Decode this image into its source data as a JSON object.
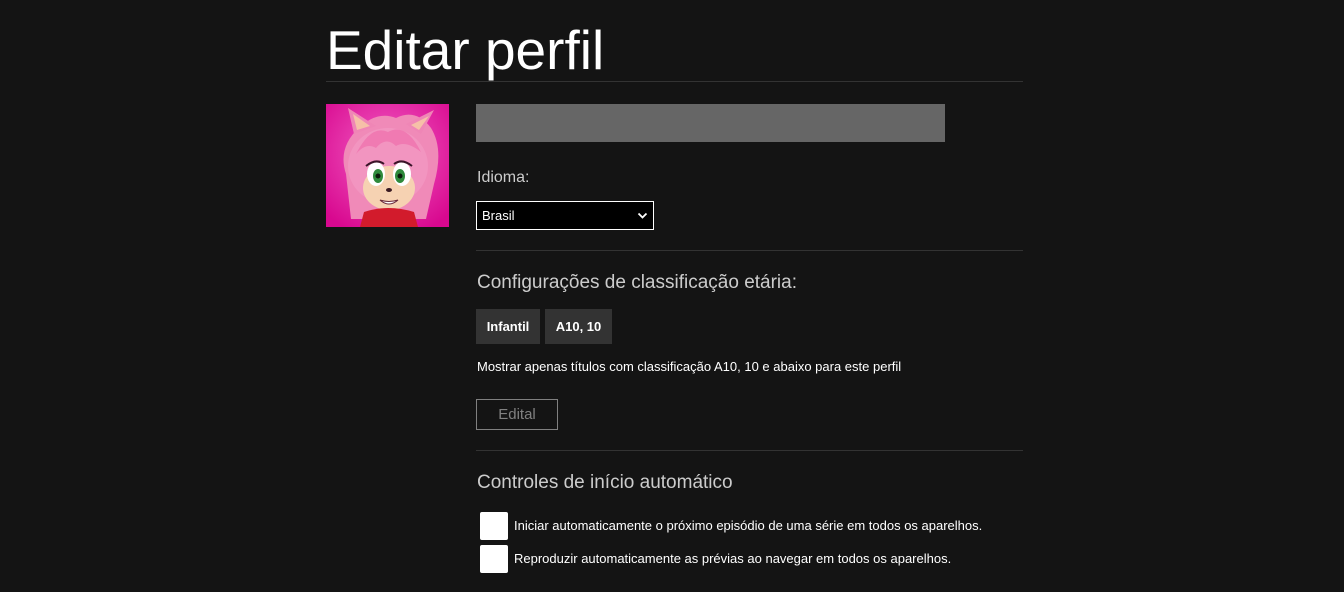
{
  "page": {
    "title": "Editar perfil"
  },
  "profile": {
    "name_value": "",
    "avatar_icon": "amy-rose-avatar"
  },
  "language": {
    "label": "Idioma:",
    "selected": "Brasil"
  },
  "maturity": {
    "title": "Configurações de classificação etária:",
    "pills": [
      "Infantil",
      "A10, 10"
    ],
    "description": "Mostrar apenas títulos com classificação A10, 10 e abaixo para este perfil",
    "edit_label": "Edital"
  },
  "autoplay": {
    "title": "Controles de início automático",
    "options": [
      {
        "label": "Iniciar automaticamente o próximo episódio de uma série em todos os aparelhos.",
        "checked": false
      },
      {
        "label": "Reproduzir automaticamente as prévias ao navegar em todos os aparelhos.",
        "checked": false
      }
    ]
  },
  "colors": {
    "background": "#141414",
    "avatar_background": "#e40c9e",
    "input_background": "#666666",
    "pill_background": "#333333"
  }
}
